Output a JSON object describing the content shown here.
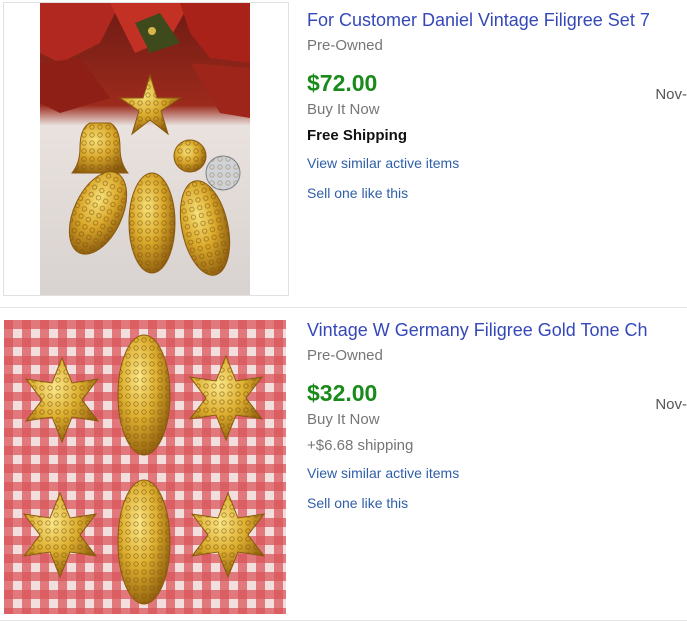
{
  "listings": [
    {
      "title": "For Customer Daniel Vintage Filigree Set 7",
      "condition": "Pre-Owned",
      "price": "$72.00",
      "format": "Buy It Now",
      "shipping": "Free Shipping",
      "similar_link": "View similar active items",
      "sell_link": "Sell one like this",
      "date": "Nov-"
    },
    {
      "title": "Vintage W Germany Filigree Gold Tone Ch",
      "condition": "Pre-Owned",
      "price": "$32.00",
      "format": "Buy It Now",
      "shipping": "+$6.68 shipping",
      "similar_link": "View similar active items",
      "sell_link": "Sell one like this",
      "date": "Nov-"
    }
  ],
  "colors": {
    "title_link": "#3548b9",
    "price": "#1a8a1a",
    "action_link": "#2f5fa8"
  }
}
